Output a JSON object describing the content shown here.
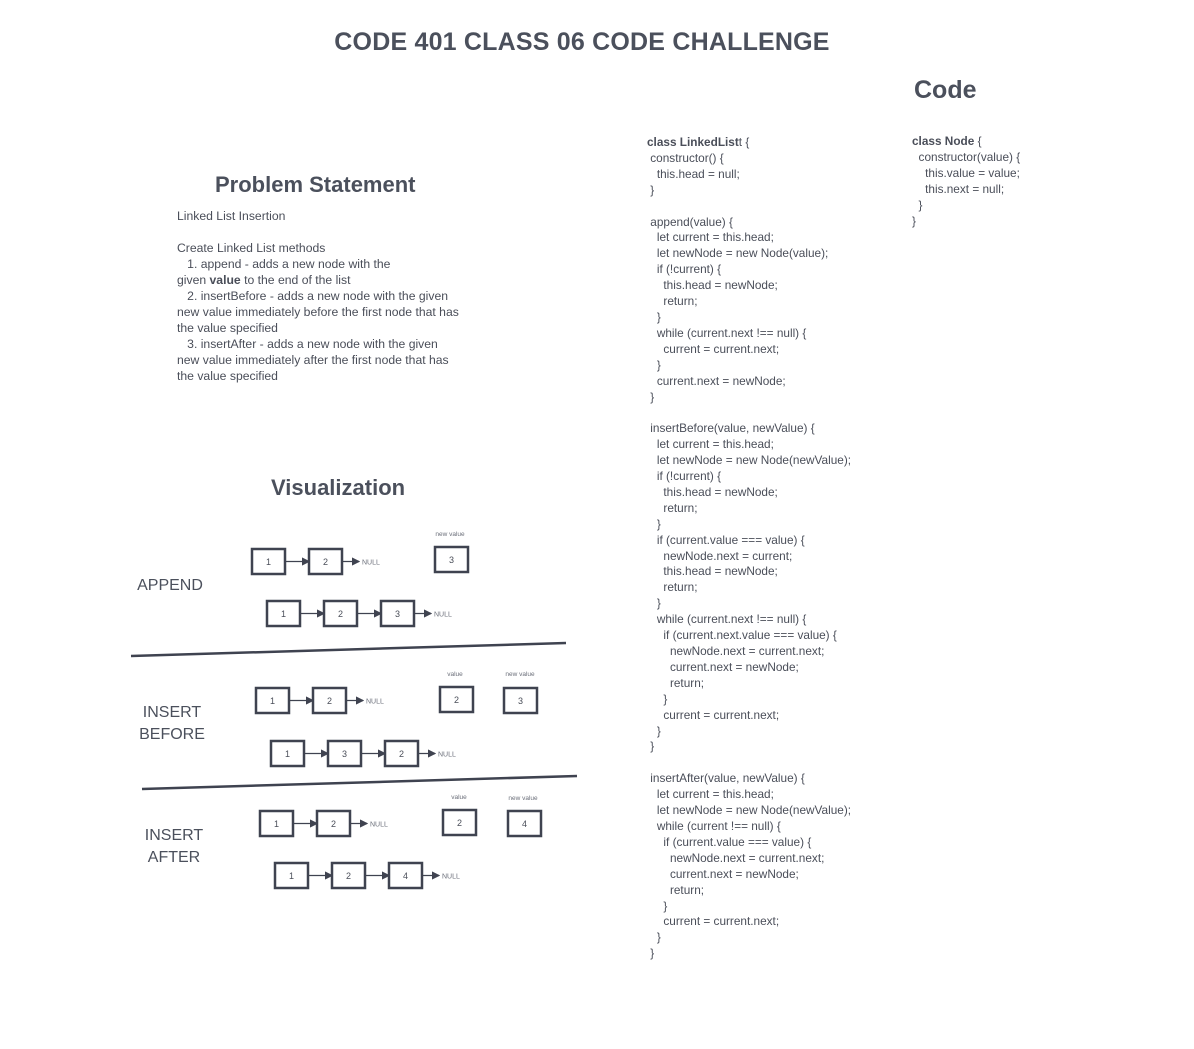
{
  "title": "CODE 401 CLASS 06 CODE CHALLENGE",
  "problem": {
    "heading": "Problem Statement",
    "subtitle": "Linked List Insertion",
    "intro": "Create Linked List methods",
    "item1_a": "   1. append - adds a new node with the",
    "item1_b_pre": "given ",
    "item1_b_bold": "value",
    "item1_b_post": " to the end of the list",
    "item2": "   2. insertBefore - adds a new node with the given\nnew value immediately before the first node that has\nthe value specified",
    "item3": "   3. insertAfter - adds a new node with the given\nnew value immediately after the first node that has\nthe value specified"
  },
  "visualization": {
    "heading": "Visualization",
    "null_text": "NULL",
    "value_label": "value",
    "new_value_label": "new value",
    "append": {
      "label": "APPEND",
      "before": [
        "1",
        "2"
      ],
      "new_value": "3",
      "after": [
        "1",
        "2",
        "3"
      ]
    },
    "insert_before": {
      "label_line1": "INSERT",
      "label_line2": "BEFORE",
      "before": [
        "1",
        "2"
      ],
      "value": "2",
      "new_value": "3",
      "after": [
        "1",
        "3",
        "2"
      ]
    },
    "insert_after": {
      "label_line1": "INSERT",
      "label_line2": "AFTER",
      "before": [
        "1",
        "2"
      ],
      "value": "2",
      "new_value": "4",
      "after": [
        "1",
        "2",
        "4"
      ]
    }
  },
  "code": {
    "heading": "Code",
    "linked_list_kw": "class LinkedList",
    "linked_list_rest": "t {",
    "linked_list_body": " constructor() {\n   this.head = null;\n }\n\n append(value) {\n   let current = this.head;\n   let newNode = new Node(value);\n   if (!current) {\n     this.head = newNode;\n     return;\n   }\n   while (current.next !== null) {\n     current = current.next;\n   }\n   current.next = newNode;\n }\n\n insertBefore(value, newValue) {\n   let current = this.head;\n   let newNode = new Node(newValue);\n   if (!current) {\n     this.head = newNode;\n     return;\n   }\n   if (current.value === value) {\n     newNode.next = current;\n     this.head = newNode;\n     return;\n   }\n   while (current.next !== null) {\n     if (current.next.value === value) {\n       newNode.next = current.next;\n       current.next = newNode;\n       return;\n     }\n     current = current.next;\n   }\n }\n\n insertAfter(value, newValue) {\n   let current = this.head;\n   let newNode = new Node(newValue);\n   while (current !== null) {\n     if (current.value === value) {\n       newNode.next = current.next;\n       current.next = newNode;\n       return;\n     }\n     current = current.next;\n   }\n }",
    "node_kw": "class Node",
    "node_rest": " {",
    "node_body": "  constructor(value) {\n    this.value = value;\n    this.next = null;\n  }\n}"
  },
  "colors": {
    "box_stroke": "#3f4350",
    "text": "#4a4e59"
  }
}
